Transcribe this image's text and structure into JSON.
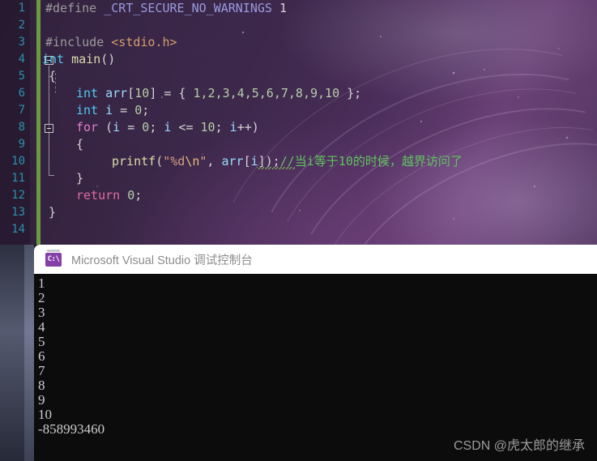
{
  "editor": {
    "line_numbers": [
      "1",
      "2",
      "3",
      "4",
      "5",
      "6",
      "7",
      "8",
      "9",
      "10",
      "11",
      "12",
      "13",
      "14"
    ],
    "lines": [
      {
        "n": 1,
        "text": "#define _CRT_SECURE_NO_WARNINGS 1"
      },
      {
        "n": 2,
        "text": ""
      },
      {
        "n": 3,
        "text": "#include <stdio.h>"
      },
      {
        "n": 4,
        "text": "int main()"
      },
      {
        "n": 5,
        "text": "{"
      },
      {
        "n": 6,
        "text": "    int arr[10] = { 1,2,3,4,5,6,7,8,9,10 };"
      },
      {
        "n": 7,
        "text": "    int i = 0;"
      },
      {
        "n": 8,
        "text": "    for (i = 0; i <= 10; i++)"
      },
      {
        "n": 9,
        "text": "    {"
      },
      {
        "n": 10,
        "text": "        printf(\"%d\\n\", arr[i]);//当i等于10的时候，越界访问了"
      },
      {
        "n": 11,
        "text": "    }"
      },
      {
        "n": 12,
        "text": "    return 0;"
      },
      {
        "n": 13,
        "text": "}"
      },
      {
        "n": 14,
        "text": ""
      }
    ],
    "tokens": {
      "l1_define": "#define",
      "l1_macro": "_CRT_SECURE_NO_WARNINGS",
      "l1_value": "1",
      "l3_include": "#include",
      "l3_header": "<stdio.h>",
      "l4_int": "int",
      "l4_main": "main",
      "l4_parens": "()",
      "l5_brace": "{",
      "l6_int": "int",
      "l6_arr": "arr",
      "l6_bracket_open": "[",
      "l6_size": "10",
      "l6_bracket_close": "]",
      "l6_eq": " = { ",
      "l6_values": "1,2,3,4,5,6,7,8,9,10",
      "l6_end": " };",
      "l7_int": "int",
      "l7_i": "i",
      "l7_eq": " = ",
      "l7_zero": "0",
      "l7_semi": ";",
      "l8_for": "for",
      "l8_open": " (",
      "l8_i1": "i",
      "l8_eq1": " = ",
      "l8_z1": "0",
      "l8_semi1": "; ",
      "l8_i2": "i",
      "l8_cond": " <= ",
      "l8_ten": "10",
      "l8_semi2": "; ",
      "l8_i3": "i",
      "l8_inc": "++)",
      "l9_brace": "{",
      "l10_printf": "printf",
      "l10_paren": "(",
      "l10_q1": "\"",
      "l10_fmt": "%d",
      "l10_esc": "\\n",
      "l10_q2": "\"",
      "l10_comma": ", ",
      "l10_arr": "arr",
      "l10_b1": "[",
      "l10_i": "i",
      "l10_b2": "]",
      "l10_close": ");",
      "l10_comment": "//当i等于10的时候，越界访问了",
      "l11_brace": "}",
      "l12_return": "return",
      "l12_zero": " 0",
      "l12_semi": ";",
      "l13_brace": "}"
    },
    "colors": {
      "line_number": "#2b91af",
      "keyword": "#4ec9f0",
      "control_keyword": "#e07fd0",
      "function": "#dcdcaa",
      "number": "#b5cea8",
      "string": "#d69d85",
      "comment": "#5fc45f",
      "saved_indicator": "#6a9b3f"
    }
  },
  "console": {
    "title": "Microsoft Visual Studio 调试控制台",
    "icon": "command-prompt-icon",
    "icon_text": "C:\\",
    "output_lines": [
      "1",
      "2",
      "3",
      "4",
      "5",
      "6",
      "7",
      "8",
      "9",
      "10",
      "-858993460"
    ],
    "background": "#0c0c0c",
    "text_color": "#cccccc"
  },
  "watermark": {
    "text": "CSDN @虎太郎的继承"
  }
}
